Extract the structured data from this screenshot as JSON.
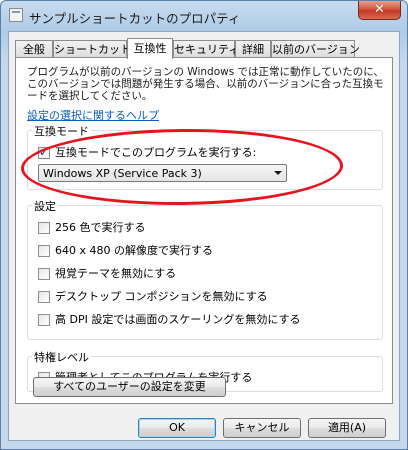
{
  "window": {
    "title": "サンプルショートカットのプロパティ",
    "close_label": "✕"
  },
  "tabs": [
    {
      "label": "全般",
      "active": false
    },
    {
      "label": "ショートカット",
      "active": false
    },
    {
      "label": "互換性",
      "active": true
    },
    {
      "label": "セキュリティ",
      "active": false
    },
    {
      "label": "詳細",
      "active": false
    },
    {
      "label": "以前のバージョン",
      "active": false
    }
  ],
  "description": "プログラムが以前のバージョンの Windows では正常に動作していたのに、このバージョンでは問題が発生する場合、以前のバージョンに合った互換モードを選択してください。",
  "help_link": "設定の選択に関するヘルプ",
  "compat_mode": {
    "legend": "互換モード",
    "checkbox_label": "互換モードでこのプログラムを実行する:",
    "checked": true,
    "select_value": "Windows XP (Service Pack 3)"
  },
  "settings": {
    "legend": "設定",
    "items": [
      {
        "label": "256 色で実行する",
        "checked": false
      },
      {
        "label": "640 x 480 の解像度で実行する",
        "checked": false
      },
      {
        "label": "視覚テーマを無効にする",
        "checked": false
      },
      {
        "label": "デスクトップ コンポジションを無効にする",
        "checked": false
      },
      {
        "label": "高 DPI 設定では画面のスケーリングを無効にする",
        "checked": false
      }
    ]
  },
  "privilege": {
    "legend": "特権レベル",
    "checkbox_label": "管理者としてこのプログラムを実行する",
    "checked": false
  },
  "all_users_button": "すべてのユーザーの設定を変更",
  "buttons": {
    "ok": "OK",
    "cancel": "キャンセル",
    "apply": "適用(A)"
  },
  "annotation_color": "#e8141c"
}
